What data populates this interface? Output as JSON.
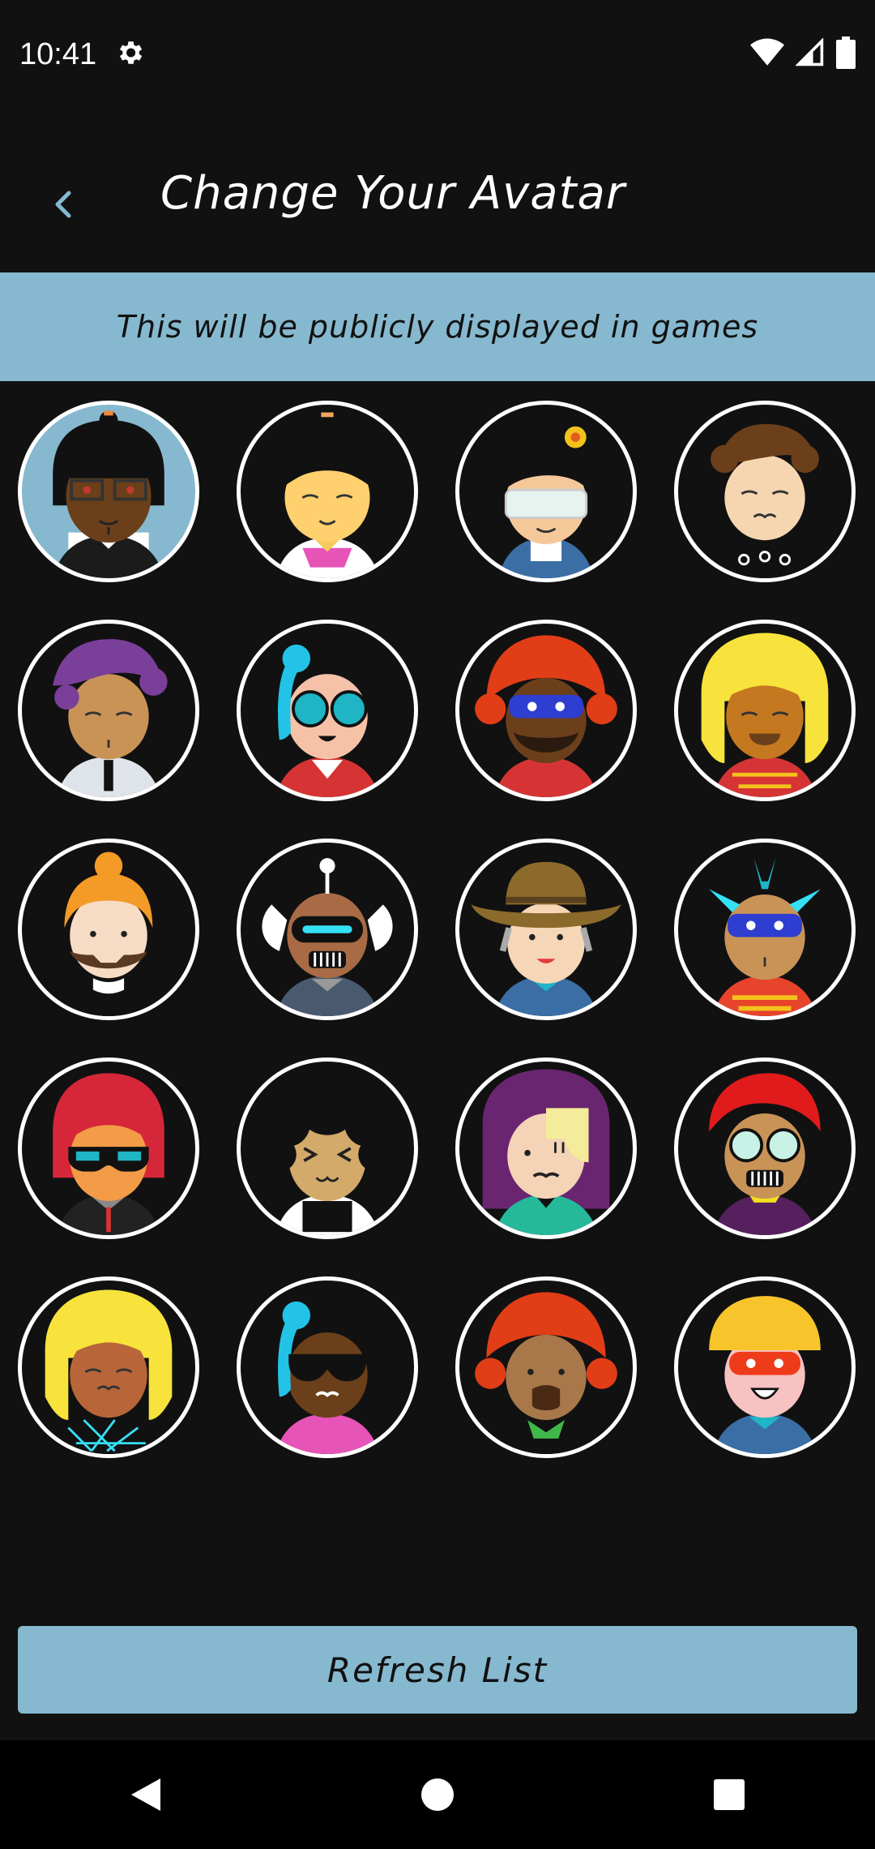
{
  "status_bar": {
    "time": "10:41",
    "icons": [
      "gear-icon",
      "wifi-icon",
      "signal-icon",
      "battery-icon"
    ]
  },
  "header": {
    "title": "Change Your Avatar",
    "back_icon": "chevron-left-icon"
  },
  "banner": {
    "text": "This will be publicly displayed in games"
  },
  "avatars": [
    {
      "name": "avatar-1",
      "selected": true
    },
    {
      "name": "avatar-2",
      "selected": false
    },
    {
      "name": "avatar-3",
      "selected": false
    },
    {
      "name": "avatar-4",
      "selected": false
    },
    {
      "name": "avatar-5",
      "selected": false
    },
    {
      "name": "avatar-6",
      "selected": false
    },
    {
      "name": "avatar-7",
      "selected": false
    },
    {
      "name": "avatar-8",
      "selected": false
    },
    {
      "name": "avatar-9",
      "selected": false
    },
    {
      "name": "avatar-10",
      "selected": false
    },
    {
      "name": "avatar-11",
      "selected": false
    },
    {
      "name": "avatar-12",
      "selected": false
    },
    {
      "name": "avatar-13",
      "selected": false
    },
    {
      "name": "avatar-14",
      "selected": false
    },
    {
      "name": "avatar-15",
      "selected": false
    },
    {
      "name": "avatar-16",
      "selected": false
    },
    {
      "name": "avatar-17",
      "selected": false
    },
    {
      "name": "avatar-18",
      "selected": false
    },
    {
      "name": "avatar-19",
      "selected": false
    },
    {
      "name": "avatar-20",
      "selected": false
    }
  ],
  "refresh_button": {
    "label": "Refresh List"
  },
  "nav_bar": {
    "icons": [
      "back-triangle-icon",
      "home-circle-icon",
      "recents-square-icon"
    ]
  },
  "colors": {
    "accent": "#86b9cf",
    "background": "#111112"
  }
}
